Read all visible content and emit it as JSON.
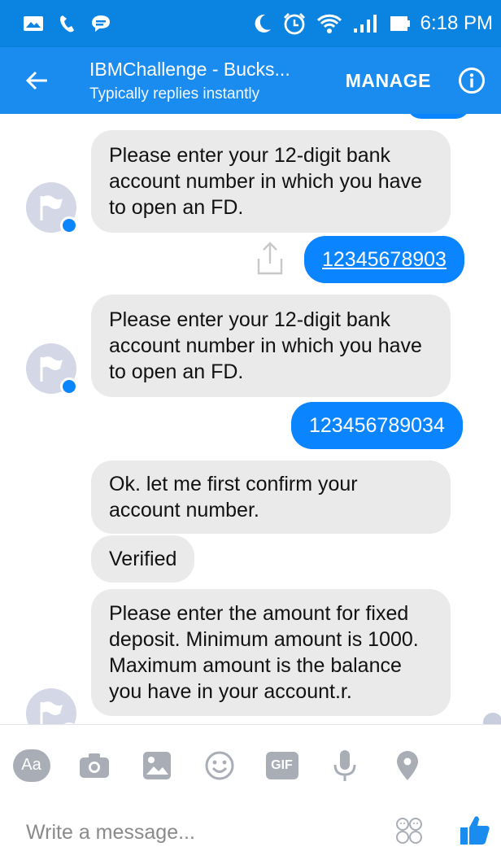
{
  "status_bar": {
    "time": "6:18 PM"
  },
  "header": {
    "title": "IBMChallenge - Bucks...",
    "subtitle": "Typically replies instantly",
    "manage_label": "MANAGE"
  },
  "messages": [
    {
      "from": "bot",
      "text": "Please enter your 12-digit bank account number in which you have to open an FD."
    },
    {
      "from": "user",
      "text": "12345678903",
      "underlined": true
    },
    {
      "from": "bot",
      "text": "Please enter your 12-digit bank account number in which you have to open an FD."
    },
    {
      "from": "user",
      "text": "123456789034"
    },
    {
      "from": "bot",
      "text": "Ok. let me first confirm your account number."
    },
    {
      "from": "bot",
      "text": "Verified"
    },
    {
      "from": "bot",
      "text": "Please enter the amount for fixed deposit. Minimum amount is 1000. Maximum amount is the balance you have in your account.r."
    }
  ],
  "toolbar": {
    "text_tool_label": "Aa",
    "gif_label": "GIF",
    "icons": [
      "text-format-icon",
      "camera-icon",
      "image-icon",
      "emoji-icon",
      "gif-icon",
      "microphone-icon",
      "location-pin-icon"
    ]
  },
  "composer": {
    "placeholder": "Write a message..."
  },
  "colors": {
    "brand": "#1a8cf0",
    "status_bar": "#0a84e0",
    "outgoing_bubble": "#0a84ff",
    "incoming_bubble": "#eaeaea"
  }
}
